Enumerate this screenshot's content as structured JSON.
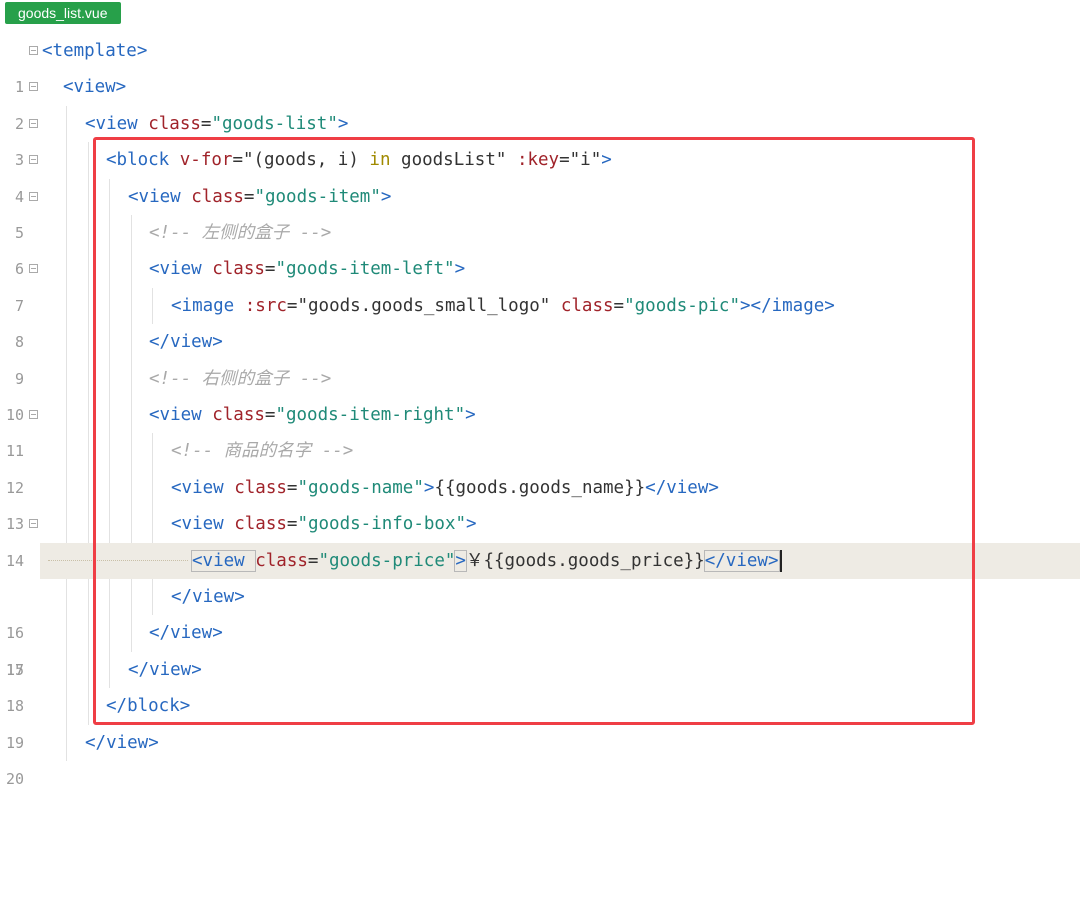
{
  "tab": {
    "filename": "goods_list.vue"
  },
  "lines": [
    {
      "n": "1",
      "code": [
        "<template>"
      ]
    },
    {
      "n": "2",
      "code": [
        "<view>"
      ]
    },
    {
      "n": "3",
      "code": [
        "<view ",
        "class",
        "=",
        "\"goods-list\"",
        ">"
      ]
    },
    {
      "n": "4",
      "code": [
        "<block ",
        "v-for",
        "=\"(goods, i) ",
        "in",
        " goodsList\" ",
        ":key",
        "=\"i\"",
        ">"
      ]
    },
    {
      "n": "5",
      "code": [
        "<view ",
        "class",
        "=",
        "\"goods-item\"",
        ">"
      ]
    },
    {
      "n": "6",
      "code": [
        "<!-- 左侧的盒子 -->"
      ]
    },
    {
      "n": "7",
      "code": [
        "<view ",
        "class",
        "=",
        "\"goods-item-left\"",
        ">"
      ]
    },
    {
      "n": "8",
      "code": [
        "<image ",
        ":src",
        "=\"goods.goods_small_logo\" ",
        "class",
        "=",
        "\"goods-pic\"",
        "></image>"
      ]
    },
    {
      "n": "9",
      "code": [
        "</view>"
      ]
    },
    {
      "n": "10",
      "code": [
        "<!-- 右侧的盒子 -->"
      ]
    },
    {
      "n": "11",
      "code": [
        "<view ",
        "class",
        "=",
        "\"goods-item-right\"",
        ">"
      ]
    },
    {
      "n": "12",
      "code": [
        "<!-- 商品的名字 -->"
      ]
    },
    {
      "n": "13",
      "code": [
        "<view ",
        "class",
        "=",
        "\"goods-name\"",
        ">",
        "{{goods.goods_name}}",
        "</view>"
      ]
    },
    {
      "n": "14",
      "code": [
        "<view ",
        "class",
        "=",
        "\"goods-info-box\"",
        ">"
      ]
    },
    {
      "n": "15",
      "code": [
        "<view ",
        "class",
        "=",
        "\"goods-price\"",
        ">",
        "￥{{goods.goods_price}}",
        "</view>"
      ]
    },
    {
      "n": "16",
      "code": [
        "</view>"
      ]
    },
    {
      "n": "17",
      "code": [
        "</view>"
      ]
    },
    {
      "n": "18",
      "code": [
        "</view>"
      ]
    },
    {
      "n": "19",
      "code": [
        "</block>"
      ]
    },
    {
      "n": "20",
      "code": [
        "</view>"
      ]
    }
  ],
  "colors": {
    "tab": "#27a04a",
    "highlight_box": "#ef3e45",
    "current_line": "#eeebe4"
  }
}
